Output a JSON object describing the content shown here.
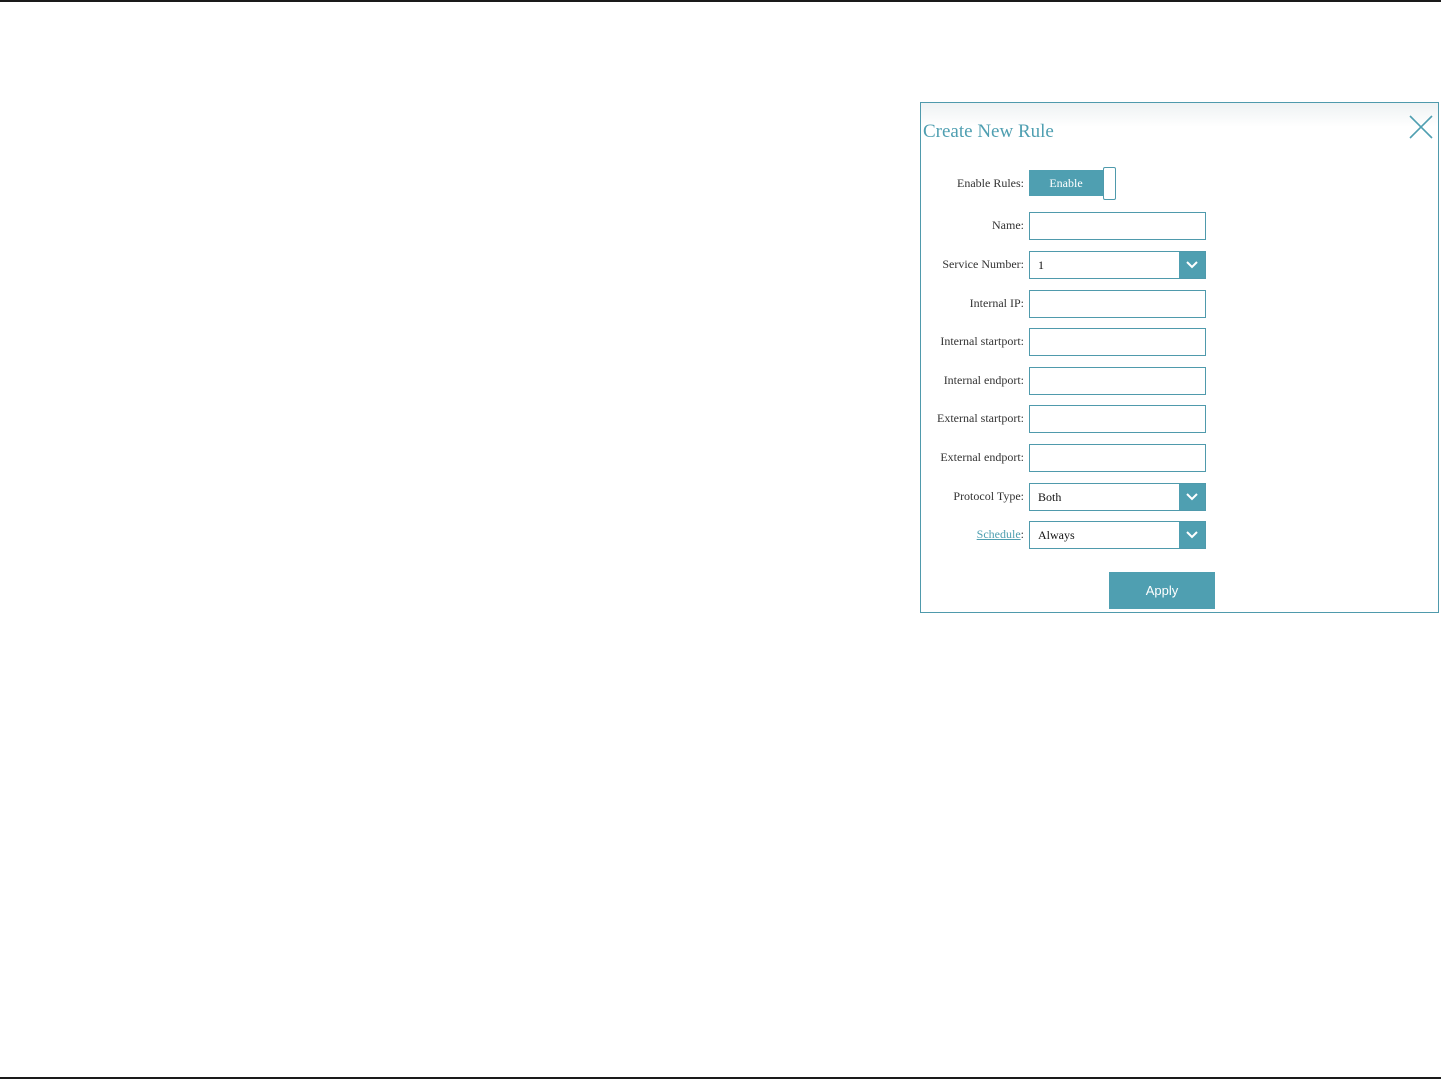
{
  "dialog": {
    "title": "Create New Rule",
    "close_icon": "close-icon",
    "accent_color": "#4f9fb1"
  },
  "form": {
    "enable_rules": {
      "label": "Enable Rules",
      "toggle_label": "Enable",
      "state": "on"
    },
    "name": {
      "label": "Name",
      "value": ""
    },
    "service_number": {
      "label": "Service Number",
      "selected": "1"
    },
    "internal_ip": {
      "label": "Internal IP",
      "value": ""
    },
    "internal_startport": {
      "label": "Internal startport",
      "value": ""
    },
    "internal_endport": {
      "label": "Internal endport",
      "value": ""
    },
    "external_startport": {
      "label": "External startport",
      "value": ""
    },
    "external_endport": {
      "label": "External endport",
      "value": ""
    },
    "protocol_type": {
      "label": "Protocol Type",
      "selected": "Both"
    },
    "schedule": {
      "label": "Schedule",
      "selected": "Always"
    },
    "colon": ":"
  },
  "actions": {
    "apply_label": "Apply"
  }
}
